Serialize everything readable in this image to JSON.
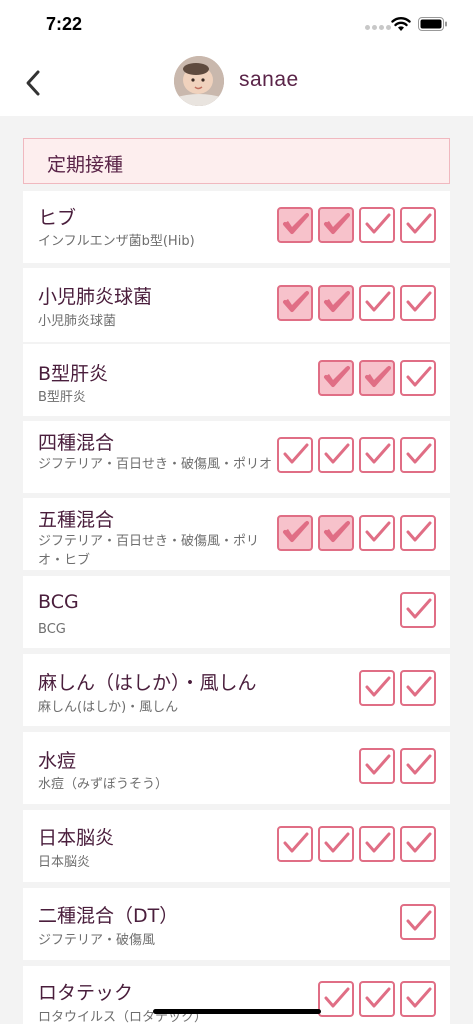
{
  "status_bar": {
    "time": "7:22"
  },
  "nav": {
    "back_icon": "chevron-left-icon",
    "user_name": "sanae"
  },
  "section": {
    "title": "定期接種"
  },
  "vaccines": [
    {
      "name": "ヒブ",
      "sub": "インフルエンザ菌b型(Hib)",
      "doses": [
        true,
        true,
        false,
        false
      ]
    },
    {
      "name": "小児肺炎球菌",
      "sub": "小児肺炎球菌",
      "doses": [
        true,
        true,
        false,
        false
      ]
    },
    {
      "name": "B型肝炎",
      "sub": "B型肝炎",
      "doses": [
        true,
        true,
        false
      ]
    },
    {
      "name": "四種混合",
      "sub": "ジフテリア・百日せき・破傷風・ポリオ",
      "doses": [
        false,
        false,
        false,
        false
      ]
    },
    {
      "name": "五種混合",
      "sub": "ジフテリア・百日せき・破傷風・ポリオ・ヒブ",
      "doses": [
        true,
        true,
        false,
        false
      ]
    },
    {
      "name": "BCG",
      "sub": "BCG",
      "doses": [
        false
      ]
    },
    {
      "name": "麻しん（はしか）・風しん",
      "sub": "麻しん(はしか)・風しん",
      "doses": [
        false,
        false
      ]
    },
    {
      "name": "水痘",
      "sub": "水痘（みずぼうそう）",
      "doses": [
        false,
        false
      ]
    },
    {
      "name": "日本脳炎",
      "sub": "日本脳炎",
      "doses": [
        false,
        false,
        false,
        false
      ]
    },
    {
      "name": "二種混合（DT）",
      "sub": "ジフテリア・破傷風",
      "doses": [
        false
      ]
    },
    {
      "name": "ロタテック",
      "sub": "ロタウイルス（ロタテック）",
      "doses": [
        false,
        false,
        false
      ]
    }
  ],
  "colors": {
    "accent": "#e06e85",
    "checked_fill": "#f7c2cb",
    "title": "#5a2448"
  }
}
